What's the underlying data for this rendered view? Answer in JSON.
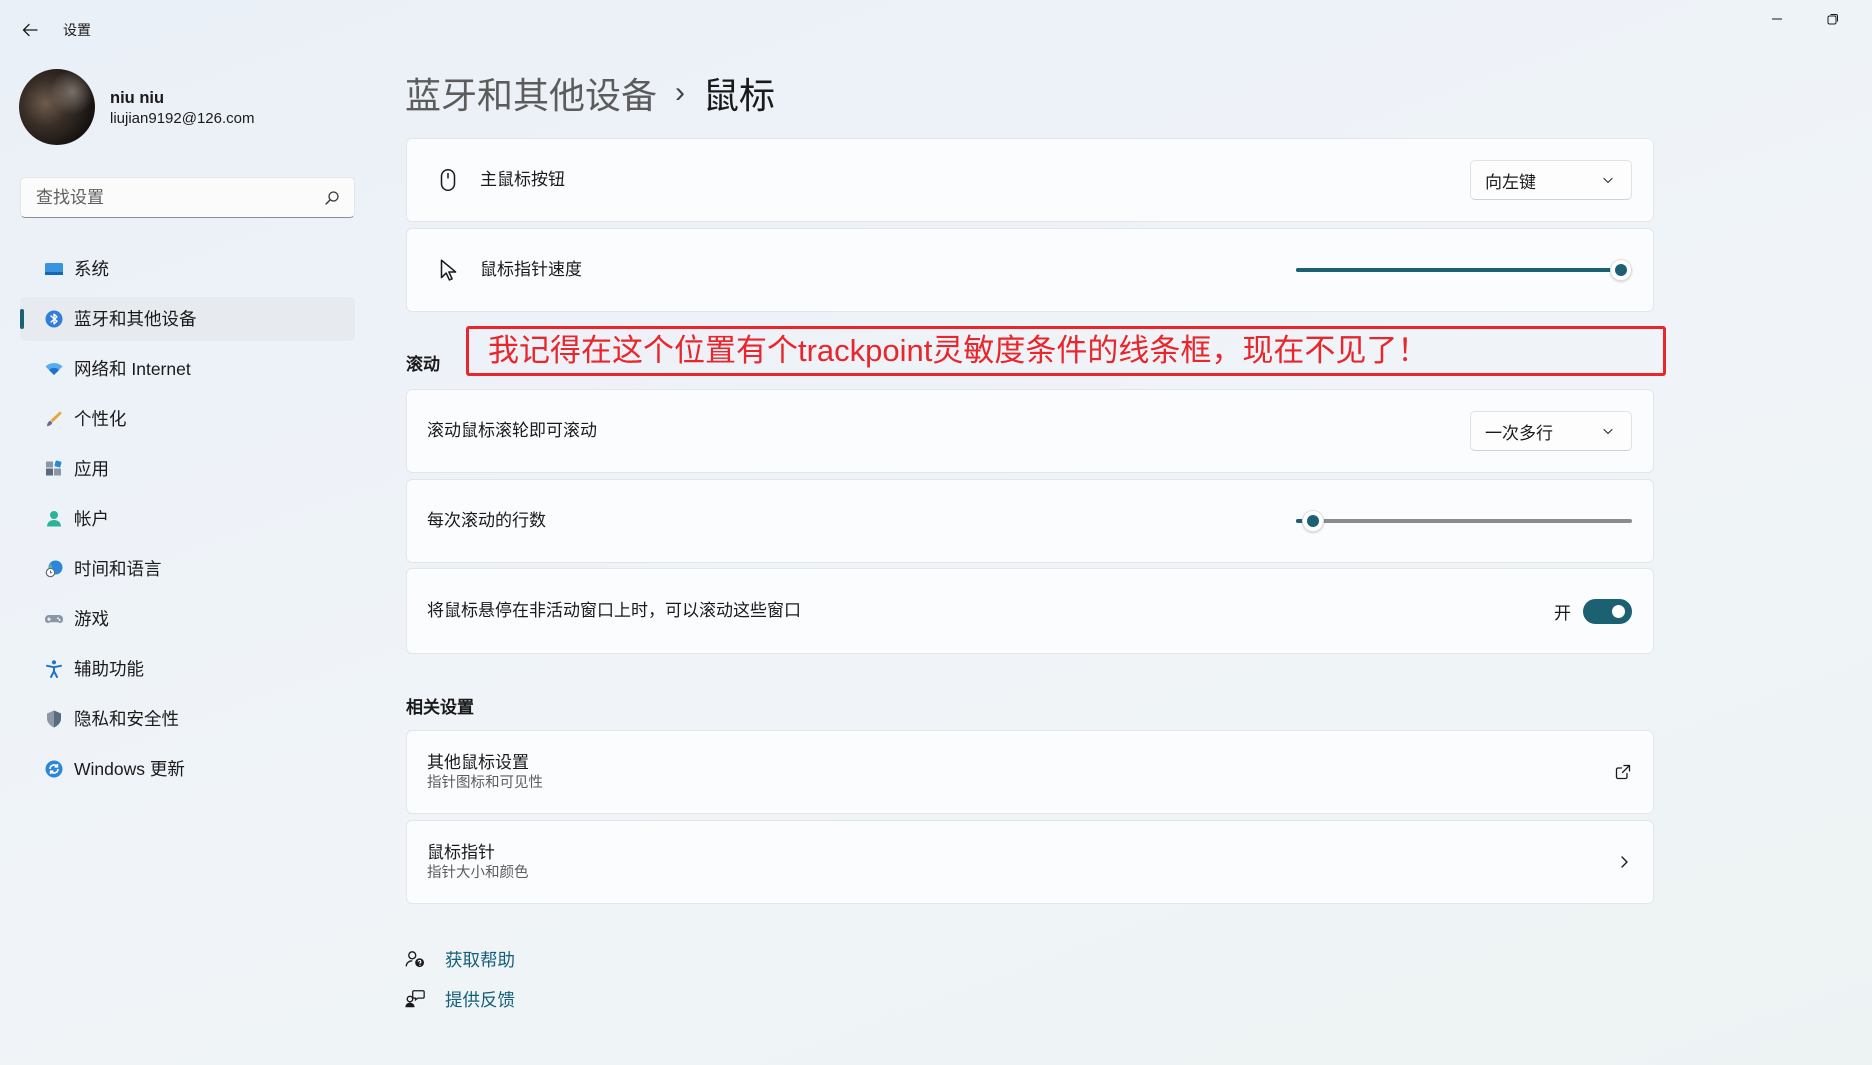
{
  "colors": {
    "accent": "#1b6172",
    "annotation": "#e8262b",
    "link": "#155e7a"
  },
  "window": {
    "title": "设置",
    "icons": {
      "back": "back-arrow-icon",
      "minimize": "minimize-icon",
      "restore": "restore-icon"
    }
  },
  "user": {
    "name": "niu niu",
    "email": "liujian9192@126.com"
  },
  "search": {
    "placeholder": "查找设置",
    "icon": "search-icon"
  },
  "nav": {
    "selected": 1,
    "items": [
      {
        "label": "系统",
        "icon": "system-icon"
      },
      {
        "label": "蓝牙和其他设备",
        "icon": "bluetooth-icon"
      },
      {
        "label": "网络和 Internet",
        "icon": "network-icon"
      },
      {
        "label": "个性化",
        "icon": "personalization-icon"
      },
      {
        "label": "应用",
        "icon": "apps-icon"
      },
      {
        "label": "帐户",
        "icon": "accounts-icon"
      },
      {
        "label": "时间和语言",
        "icon": "time-language-icon"
      },
      {
        "label": "游戏",
        "icon": "gaming-icon"
      },
      {
        "label": "辅助功能",
        "icon": "accessibility-icon"
      },
      {
        "label": "隐私和安全性",
        "icon": "privacy-icon"
      },
      {
        "label": "Windows 更新",
        "icon": "windows-update-icon"
      }
    ]
  },
  "breadcrumb": {
    "parent": "蓝牙和其他设备",
    "separator": "›",
    "current": "鼠标"
  },
  "mouse": {
    "primary_button": {
      "label": "主鼠标按钮",
      "value": "向左键",
      "icon": "mouse-icon"
    },
    "pointer_speed": {
      "label": "鼠标指针速度",
      "level": 1.0,
      "icon": "cursor-icon"
    }
  },
  "annotation": {
    "text": "我记得在这个位置有个trackpoint灵敏度条件的线条框，现在不见了！"
  },
  "scrolling": {
    "heading": "滚动",
    "wheel": {
      "label": "滚动鼠标滚轮即可滚动",
      "value": "一次多行"
    },
    "lines": {
      "label": "每次滚动的行数",
      "level": 0.02
    },
    "inactive": {
      "label": "将鼠标悬停在非活动窗口上时，可以滚动这些窗口",
      "state_label": "开",
      "on": true
    }
  },
  "related": {
    "heading": "相关设置",
    "items": [
      {
        "title": "其他鼠标设置",
        "subtitle": "指针图标和可见性",
        "icon": "external-link-icon"
      },
      {
        "title": "鼠标指针",
        "subtitle": "指针大小和颜色",
        "icon": "chevron-right-icon"
      }
    ]
  },
  "footer": {
    "help": {
      "label": "获取帮助",
      "icon": "help-icon"
    },
    "feedback": {
      "label": "提供反馈",
      "icon": "feedback-icon"
    }
  }
}
